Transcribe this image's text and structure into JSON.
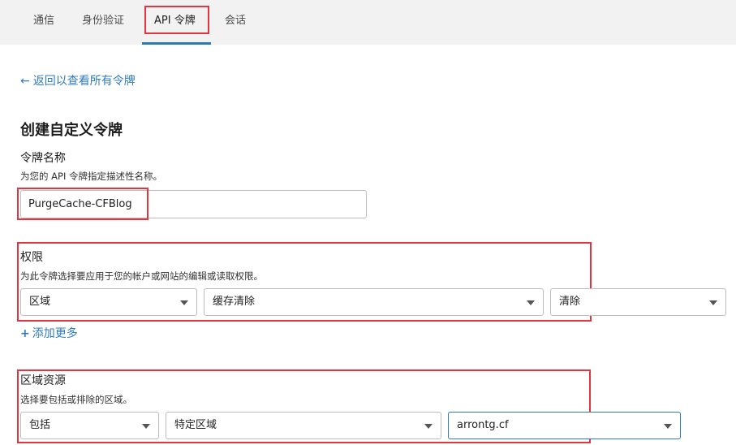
{
  "tabs": [
    {
      "label": "通信"
    },
    {
      "label": "身份验证"
    },
    {
      "label": "API 令牌"
    },
    {
      "label": "会话"
    }
  ],
  "back_link": {
    "icon": "arrow-left-icon",
    "label": "返回以查看所有令牌"
  },
  "page_title": "创建自定义令牌",
  "token_name": {
    "label": "令牌名称",
    "hint": "为您的 API 令牌指定描述性名称。",
    "value": "PurgeCache-CFBlog"
  },
  "permissions": {
    "label": "权限",
    "hint": "为此令牌选择要应用于您的帐户或网站的编辑或读取权限。",
    "selects": [
      {
        "value": "区域"
      },
      {
        "value": "缓存清除"
      },
      {
        "value": "清除"
      }
    ],
    "add_more": "添加更多"
  },
  "zone_resources": {
    "label": "区域资源",
    "hint": "选择要包括或排除的区域。",
    "selects": [
      {
        "value": "包括"
      },
      {
        "value": "特定区域"
      },
      {
        "value": "arrontg.cf"
      }
    ]
  },
  "colors": {
    "accent": "#2f7bbf",
    "highlight": "#e2353f",
    "tab_bar": "#f2f2f2"
  }
}
